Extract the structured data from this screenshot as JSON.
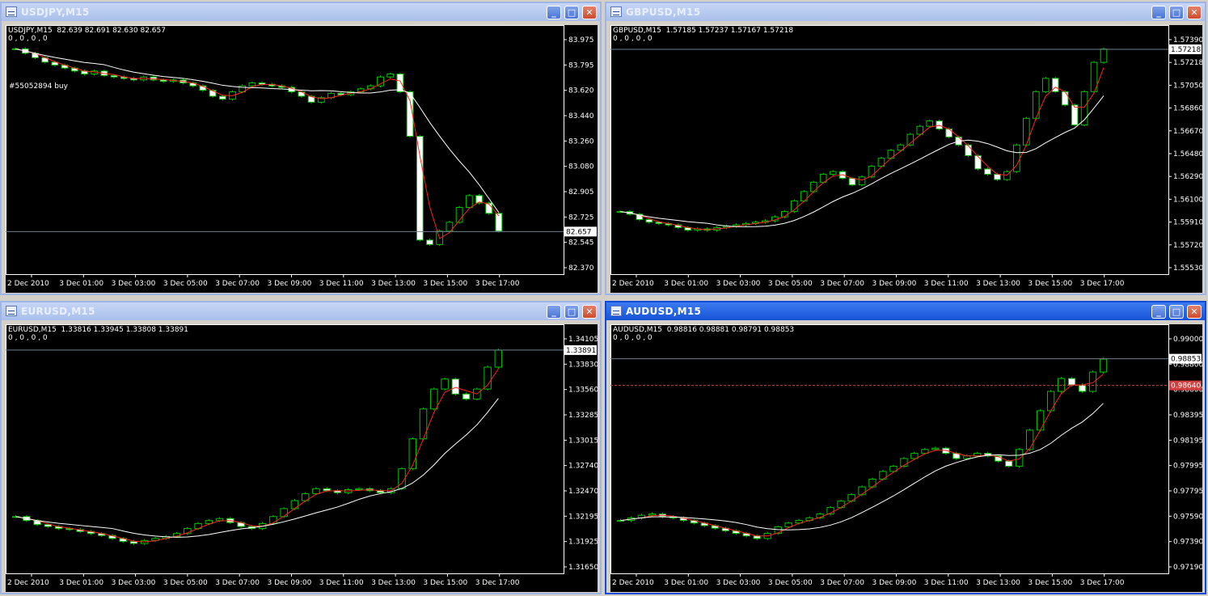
{
  "windows": [
    {
      "title": "USDJPY,M15",
      "header": "USDJPY,M15  82.639 82.691 82.630 82.657",
      "sub": "0 , 0 , 0 , 0",
      "order_label": "#55052894 buy",
      "current_price": "82.657",
      "alert_price": "",
      "y_ticks": [
        "83.975",
        "83.795",
        "83.620",
        "83.440",
        "83.260",
        "83.080",
        "82.905",
        "82.725",
        "82.545",
        "82.370"
      ],
      "x_ticks": [
        "2 Dec 2010",
        "3 Dec 01:00",
        "3 Dec 03:00",
        "3 Dec 05:00",
        "3 Dec 07:00",
        "3 Dec 09:00",
        "3 Dec 11:00",
        "3 Dec 13:00",
        "3 Dec 15:00",
        "3 Dec 17:00"
      ]
    },
    {
      "title": "GBPUSD,M15",
      "header": "GBPUSD,M15  1.57185 1.57237 1.57167 1.57218",
      "sub": "0 , 0 , 0 , 0",
      "order_label": "",
      "current_price": "1.57218",
      "alert_price": "",
      "y_ticks": [
        "1.57390",
        "1.57218",
        "1.57050",
        "1.56860",
        "1.56670",
        "1.56480",
        "1.56290",
        "1.56100",
        "1.55910",
        "1.55720",
        "1.55530"
      ],
      "x_ticks": [
        "2 Dec 2010",
        "3 Dec 01:00",
        "3 Dec 03:00",
        "3 Dec 05:00",
        "3 Dec 07:00",
        "3 Dec 09:00",
        "3 Dec 11:00",
        "3 Dec 13:00",
        "3 Dec 15:00",
        "3 Dec 17:00"
      ]
    },
    {
      "title": "EURUSD,M15",
      "header": "EURUSD,M15  1.33816 1.33945 1.33808 1.33891",
      "sub": "0 , 0 , 0 , 0",
      "order_label": "",
      "current_price": "1.33891",
      "alert_price": "",
      "y_ticks": [
        "1.34105",
        "1.33830",
        "1.33560",
        "1.33285",
        "1.33015",
        "1.32740",
        "1.32470",
        "1.32195",
        "1.31925",
        "1.31650"
      ],
      "x_ticks": [
        "2 Dec 2010",
        "3 Dec 01:00",
        "3 Dec 03:00",
        "3 Dec 05:00",
        "3 Dec 07:00",
        "3 Dec 09:00",
        "3 Dec 11:00",
        "3 Dec 13:00",
        "3 Dec 15:00",
        "3 Dec 17:00"
      ]
    },
    {
      "title": "AUDUSD,M15",
      "header": "AUDUSD,M15  0.98816 0.98881 0.98791 0.98853",
      "sub": "0 , 0 , 0 , 0",
      "order_label": "",
      "current_price": "0.98853",
      "alert_price": "0.98640",
      "y_ticks": [
        "0.99000",
        "0.98800",
        "0.98600",
        "0.98395",
        "0.98195",
        "0.97995",
        "0.97795",
        "0.97590",
        "0.97390",
        "0.97190"
      ],
      "x_ticks": [
        "2 Dec 2010",
        "3 Dec 01:00",
        "3 Dec 03:00",
        "3 Dec 05:00",
        "3 Dec 07:00",
        "3 Dec 09:00",
        "3 Dec 11:00",
        "3 Dec 13:00",
        "3 Dec 15:00",
        "3 Dec 17:00"
      ]
    }
  ],
  "buttons": {
    "minimize": "_",
    "maximize": "□",
    "close": "✕"
  },
  "chart_data": [
    {
      "type": "candlestick",
      "symbol": "USDJPY",
      "timeframe": "M15",
      "ylim": [
        82.37,
        84.05
      ],
      "close_series": [
        83.89,
        83.86,
        83.83,
        83.8,
        83.78,
        83.76,
        83.74,
        83.72,
        83.74,
        83.71,
        83.7,
        83.69,
        83.68,
        83.7,
        83.68,
        83.67,
        83.68,
        83.66,
        83.64,
        83.61,
        83.57,
        83.55,
        83.6,
        83.64,
        83.66,
        83.65,
        83.64,
        83.63,
        83.6,
        83.57,
        83.53,
        83.56,
        83.59,
        83.58,
        83.6,
        83.62,
        83.64,
        83.7,
        83.72,
        83.6,
        83.3,
        82.6,
        82.57,
        82.66,
        82.72,
        82.82,
        82.9,
        82.85,
        82.78,
        82.66
      ],
      "last": 82.657
    },
    {
      "type": "candlestick",
      "symbol": "GBPUSD",
      "timeframe": "M15",
      "ylim": [
        1.5553,
        1.574
      ],
      "close_series": [
        1.56,
        1.5598,
        1.5594,
        1.5592,
        1.5591,
        1.559,
        1.5588,
        1.5586,
        1.5587,
        1.5586,
        1.5588,
        1.5589,
        1.559,
        1.5591,
        1.5592,
        1.5593,
        1.5596,
        1.56,
        1.5608,
        1.5615,
        1.5622,
        1.5628,
        1.563,
        1.5625,
        1.562,
        1.5626,
        1.5634,
        1.564,
        1.5646,
        1.565,
        1.5658,
        1.5664,
        1.5668,
        1.5662,
        1.5656,
        1.565,
        1.5642,
        1.5632,
        1.5628,
        1.5624,
        1.563,
        1.565,
        1.567,
        1.569,
        1.57,
        1.569,
        1.568,
        1.5665,
        1.569,
        1.5712,
        1.5722
      ],
      "last": 1.57218
    },
    {
      "type": "candlestick",
      "symbol": "EURUSD",
      "timeframe": "M15",
      "ylim": [
        1.3165,
        1.3415
      ],
      "close_series": [
        1.3222,
        1.3218,
        1.3214,
        1.3212,
        1.321,
        1.3209,
        1.3207,
        1.3205,
        1.3203,
        1.32,
        1.3197,
        1.3195,
        1.3198,
        1.32,
        1.3202,
        1.3205,
        1.321,
        1.3215,
        1.3218,
        1.322,
        1.3216,
        1.3212,
        1.321,
        1.3215,
        1.3222,
        1.323,
        1.3238,
        1.3245,
        1.325,
        1.3248,
        1.3246,
        1.3249,
        1.325,
        1.3248,
        1.3246,
        1.325,
        1.327,
        1.33,
        1.333,
        1.335,
        1.336,
        1.3345,
        1.334,
        1.335,
        1.3372,
        1.3389
      ],
      "last": 1.33891
    },
    {
      "type": "candlestick",
      "symbol": "AUDUSD",
      "timeframe": "M15",
      "ylim": [
        0.9719,
        0.9912
      ],
      "close_series": [
        0.976,
        0.9762,
        0.9764,
        0.9765,
        0.9763,
        0.9762,
        0.976,
        0.9758,
        0.9756,
        0.9754,
        0.9752,
        0.975,
        0.9748,
        0.9746,
        0.975,
        0.9755,
        0.9758,
        0.976,
        0.9762,
        0.9765,
        0.977,
        0.9775,
        0.978,
        0.9786,
        0.9792,
        0.9798,
        0.9802,
        0.9808,
        0.9812,
        0.9815,
        0.9816,
        0.9812,
        0.9808,
        0.981,
        0.9812,
        0.981,
        0.9806,
        0.9802,
        0.9815,
        0.983,
        0.9845,
        0.986,
        0.987,
        0.9865,
        0.986,
        0.9875,
        0.9885
      ],
      "last": 0.98853
    }
  ]
}
